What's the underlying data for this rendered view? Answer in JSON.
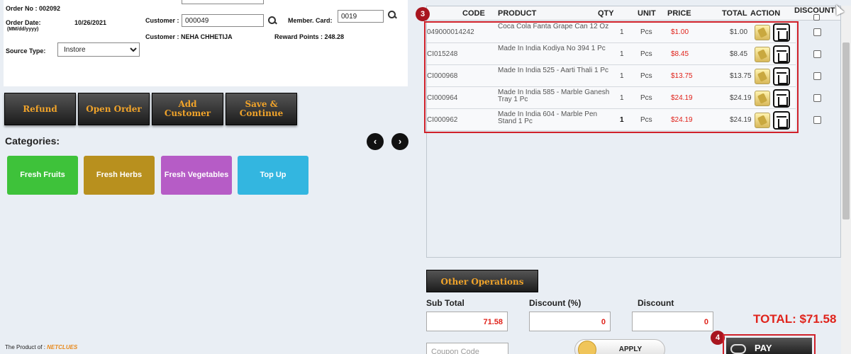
{
  "order": {
    "order_no": "Order No : 002092",
    "order_date_label": "Order Date:",
    "order_date_hint": "(MM/dd/yyyy)",
    "order_date": "10/26/2021",
    "source_type_label": "Source Type:",
    "source_type_value": "Instore",
    "customer_label": "Customer :",
    "customer_value": "000049",
    "customer_name": "Customer : NEHA CHHETIJA",
    "member_card_label": "Member. Card:",
    "member_card_value": "0019",
    "reward_points": "Reward Points : 248.28"
  },
  "actions": {
    "refund": "Refund",
    "open_order": "Open Order",
    "add_customer_line1": "Add",
    "add_customer_line2": "Customer",
    "save_continue_line1": "Save &",
    "save_continue_line2": "Continue"
  },
  "categories": {
    "title": "Categories:",
    "prev": "‹",
    "next": "›",
    "items": [
      {
        "label": "Fresh Fruits",
        "color": "#3ec23a"
      },
      {
        "label": "Fresh Herbs",
        "color": "#b8901e"
      },
      {
        "label": "Fresh Vegetables",
        "color": "#b65cc6"
      },
      {
        "label": "Top Up",
        "color": "#33b6e0"
      }
    ]
  },
  "footer": {
    "text": "The Product of :",
    "brand": "NETCLUES"
  },
  "cart": {
    "step_badge": "3",
    "headers": {
      "code": "CODE",
      "product": "PRODUCT",
      "qty": "QTY",
      "unit": "UNIT",
      "price": "PRICE",
      "total": "TOTAL",
      "action": "ACTION",
      "discount": "DISCOUNT"
    },
    "rows": [
      {
        "code": "049000014242",
        "product": "Coca Cola Fanta Grape Can 12 Oz",
        "qty": "1",
        "unit": "Pcs",
        "price": "$1.00",
        "total": "$1.00"
      },
      {
        "code": "CI015248",
        "product": "Made In India Kodiya No 394 1 Pc",
        "qty": "1",
        "unit": "Pcs",
        "price": "$8.45",
        "total": "$8.45"
      },
      {
        "code": "CI000968",
        "product": "Made In India 525 - Aarti Thali 1 Pc",
        "qty": "1",
        "unit": "Pcs",
        "price": "$13.75",
        "total": "$13.75"
      },
      {
        "code": "CI000964",
        "product": "Made In India 585 - Marble Ganesh Tray 1 Pc",
        "qty": "1",
        "unit": "Pcs",
        "price": "$24.19",
        "total": "$24.19"
      },
      {
        "code": "CI000962",
        "product": "Made In India 604 - Marble Pen Stand 1 Pc",
        "qty": "1",
        "unit": "Pcs",
        "price": "$24.19",
        "total": "$24.19"
      }
    ]
  },
  "summary": {
    "other_operations": "Other Operations",
    "sub_total_label": "Sub Total",
    "sub_total_value": "71.58",
    "discount_pct_label": "Discount (%)",
    "discount_pct_value": "0",
    "discount_label": "Discount",
    "discount_value": "0",
    "grand_total": "TOTAL: $71.58",
    "coupon_placeholder": "Coupon Code",
    "apply": "APPLY",
    "pay_badge": "4",
    "pay": "PAY"
  }
}
